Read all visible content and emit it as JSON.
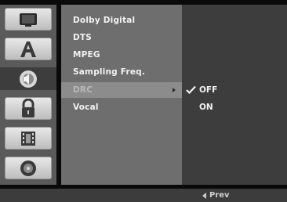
{
  "sidebar": {
    "icons": [
      {
        "name": "display-setup-icon"
      },
      {
        "name": "language-setup-icon"
      },
      {
        "name": "audio-setup-icon"
      },
      {
        "name": "lock-setup-icon"
      },
      {
        "name": "recording-setup-icon"
      },
      {
        "name": "disc-setup-icon"
      }
    ],
    "active_index": 2
  },
  "menu": {
    "items": [
      {
        "label": "Dolby Digital"
      },
      {
        "label": "DTS"
      },
      {
        "label": "MPEG"
      },
      {
        "label": "Sampling Freq."
      },
      {
        "label": "DRC"
      },
      {
        "label": "Vocal"
      }
    ],
    "selected_index": 4
  },
  "options": {
    "items": [
      {
        "label": "OFF",
        "checked": true
      },
      {
        "label": "ON",
        "checked": false
      }
    ]
  },
  "footer": {
    "prev_label": "Prev"
  },
  "colors": {
    "background": "#0a0a0a",
    "icon_column": "#5a5a5a",
    "menu_panel": "#6e6e6e",
    "menu_selected": "#8c8c8c",
    "options_panel": "#3d3d3d",
    "bottom_bar": "#3c3c3c"
  }
}
